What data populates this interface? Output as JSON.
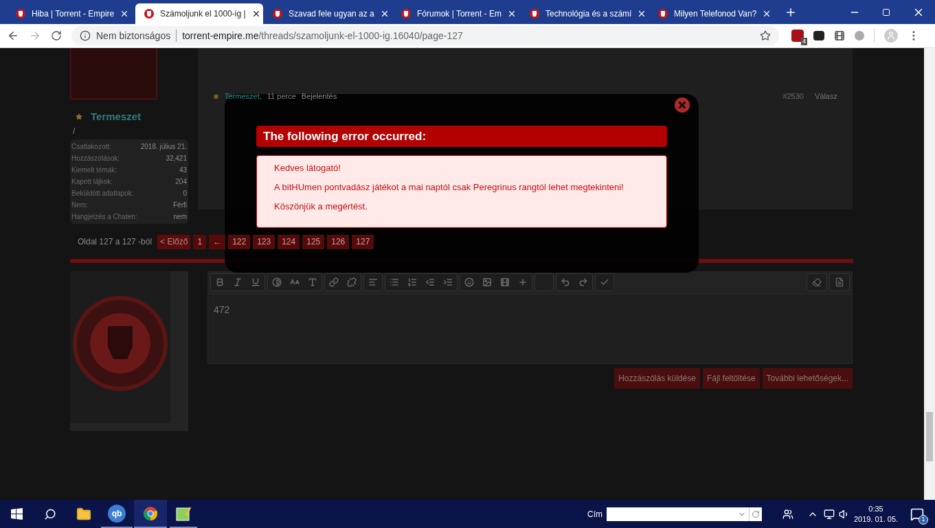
{
  "browser": {
    "tabs": [
      {
        "title": "Hiba | Torrent - Empire",
        "selected": false
      },
      {
        "title": "Számoljunk el 1000-ig |",
        "selected": true
      },
      {
        "title": "Szavad fele ugyan az a",
        "selected": false
      },
      {
        "title": "Fórumok | Torrent - Em",
        "selected": false
      },
      {
        "title": "Technológia és a számí",
        "selected": false
      },
      {
        "title": "Milyen Telefonod Van?",
        "selected": false
      }
    ],
    "security": "Nem biztonságos",
    "url_host": "torrent-empire.me",
    "url_path": "/threads/szamoljunk-el-1000-ig.16040/page-127",
    "extension_badge": "4"
  },
  "profile": {
    "name": "Termeszet",
    "title": "/",
    "stats": [
      {
        "label": "Csatlakozott:",
        "value": "2018. július 21."
      },
      {
        "label": "Hozzászólások:",
        "value": "32,421"
      },
      {
        "label": "Kiemelt témák:",
        "value": "43"
      },
      {
        "label": "Kapott lájkok:",
        "value": "204"
      },
      {
        "label": "Beküldött adatlapok:",
        "value": "0"
      },
      {
        "label": "Nem:",
        "value": "Férfi"
      },
      {
        "label": "Hangjelzés a Chaten:",
        "value": "nem"
      }
    ]
  },
  "post_footer": {
    "author": "Termeszet,",
    "time": "11 perce",
    "report": "Bejelentés",
    "number": "#2530",
    "reply": "Válasz"
  },
  "pagination": {
    "label": "Oldal 127 a 127 -ból",
    "previous": "< Előző",
    "pages": [
      "1",
      "←",
      "122",
      "123",
      "124",
      "125",
      "126",
      "127"
    ]
  },
  "editor": {
    "text": "472",
    "buttons": [
      "Hozzászólás küldése",
      "Fájl feltöltése",
      "További lehetőségek..."
    ]
  },
  "modal": {
    "title": "The following error occurred:",
    "messages": [
      "Kedves látogató!",
      "A bitHUmen pontvadász játékot a mai naptól csak Peregrinus rangtól lehet megtekinteni!",
      "Köszönjük a megértést."
    ]
  },
  "taskbar": {
    "qb_label": "qb",
    "address_label": "Cím",
    "time": "0:35",
    "date": "2019. 01. 05.",
    "notification_count": "1"
  }
}
